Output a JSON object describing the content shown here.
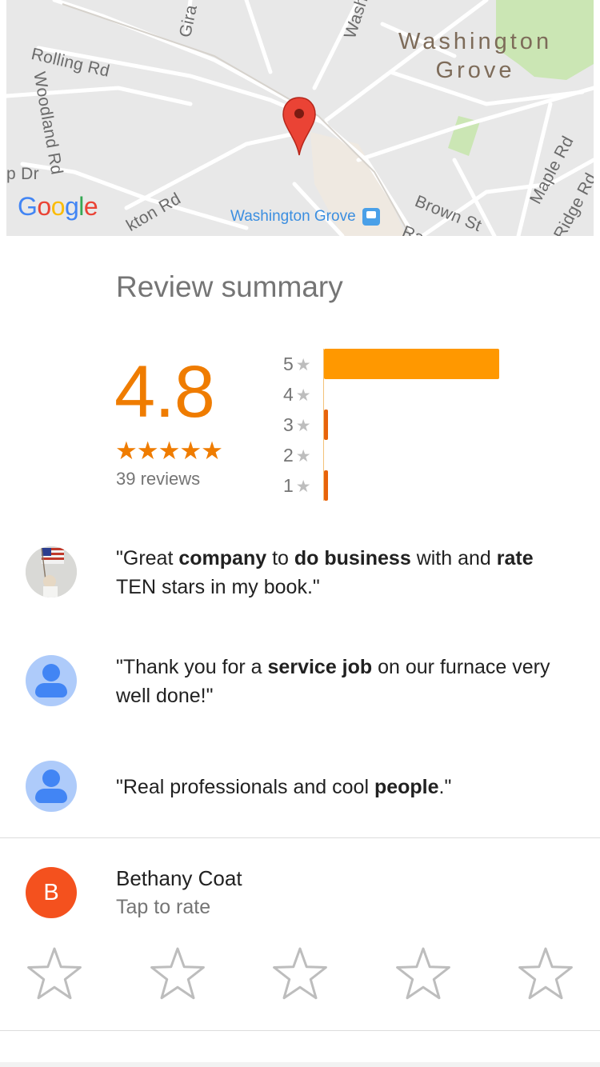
{
  "map": {
    "place_line1": "Washington",
    "place_line2": "Grove",
    "station_name": "Washington Grove",
    "google_letters": [
      "G",
      "o",
      "o",
      "g",
      "l",
      "e"
    ],
    "streets": {
      "rolling": "Rolling Rd",
      "woodland": "Woodland Rd",
      "gira": "Gira",
      "wash": "Wash",
      "pdr": "p Dr",
      "ktonrd": "kton Rd",
      "brown": "Brown St",
      "maple": "Maple Rd",
      "ridge": "Ridge Rd",
      "ra": "Ra"
    },
    "colors": {
      "park": "#cbe6b4",
      "road": "#ffffff",
      "pin": "#ea4335"
    }
  },
  "summary": {
    "title": "Review summary",
    "rating": "4.8",
    "stars": "★★★★★",
    "reviews": "39 reviews",
    "accent": "#ef7c00",
    "distribution": [
      {
        "label": "5",
        "star": "★",
        "fraction": 0.857
      },
      {
        "label": "4",
        "star": "★",
        "fraction": 0.0
      },
      {
        "label": "3",
        "star": "★",
        "fraction": 0.02
      },
      {
        "label": "2",
        "star": "★",
        "fraction": 0.0
      },
      {
        "label": "1",
        "star": "★",
        "fraction": 0.02
      }
    ]
  },
  "snippets": [
    {
      "segments": [
        {
          "t": "\"Great ",
          "b": false
        },
        {
          "t": "company",
          "b": true
        },
        {
          "t": " to ",
          "b": false
        },
        {
          "t": "do business",
          "b": true
        },
        {
          "t": " with and ",
          "b": false
        },
        {
          "t": "rate",
          "b": true
        },
        {
          "t": " TEN stars in my book.\"",
          "b": false
        }
      ]
    },
    {
      "segments": [
        {
          "t": "\"Thank you for a ",
          "b": false
        },
        {
          "t": "service job",
          "b": true
        },
        {
          "t": " on our furnace very well done!\"",
          "b": false
        }
      ]
    },
    {
      "segments": [
        {
          "t": "\"Real professionals and cool ",
          "b": false
        },
        {
          "t": "people",
          "b": true
        },
        {
          "t": ".\"",
          "b": false
        }
      ]
    }
  ],
  "rate": {
    "avatar_letter": "B",
    "name": "Bethany Coat",
    "hint": "Tap to rate",
    "star_count": 5
  }
}
